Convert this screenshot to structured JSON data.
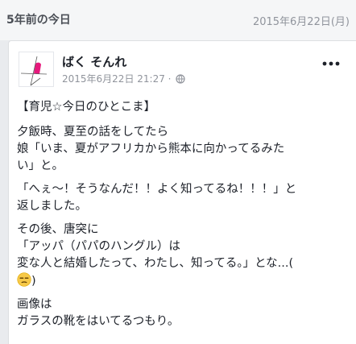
{
  "memory": {
    "label": "5年前の今日",
    "date": "2015年6月22日(月)"
  },
  "post": {
    "author": "ばく そんれ",
    "timestamp": "2015年6月22日 21:27 ·",
    "privacy_icon": "globe-icon",
    "more_icon": "more-options-icon",
    "paragraphs": {
      "p1": "【育児☆今日のひとこま】",
      "p2_l1": "夕飯時、夏至の話をしてたら",
      "p2_l2": "娘「いま、夏がアフリカから熊本に向かってるみた",
      "p2_l3": "い」と。",
      "p3_l1": "「へぇ〜！そうなんだ！！よく知ってるね！！！」と",
      "p3_l2": "返しました。",
      "p4_l1": "その後、唐突に",
      "p4_l2": "「アッパ（パパのハングル）は",
      "p4_l3": "変な人と結婚したって、わたし、知ってる。」とな...(",
      "p4_l4": ")",
      "p4_emoji": "unamused-face-emoji",
      "p5_l1": "画像は",
      "p5_l2": "ガラスの靴をはいてるつもり。"
    }
  }
}
